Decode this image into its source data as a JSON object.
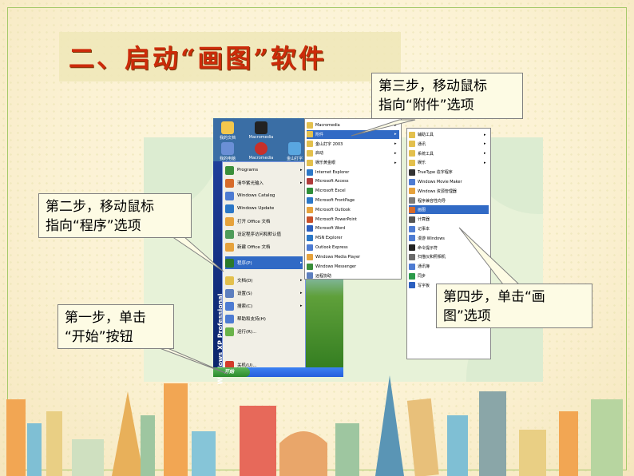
{
  "slide": {
    "title": "二、启动“画图”软件"
  },
  "callouts": {
    "step1": "第一步，单击\n“开始”按钮",
    "step2": "第二步，移动鼠标\n指向“程序”选项",
    "step3": "第三步，移动鼠标\n指向“附件”选项",
    "step4": "第四步，单击“画\n图”选项"
  },
  "desktop": {
    "icons": [
      "我的文档",
      "Macromedia",
      "我的电脑",
      "Macromedia",
      "金山打字"
    ]
  },
  "start_menu": {
    "side_label": "Windows XP Professional",
    "start_button": "开始",
    "items": [
      {
        "label": "Programs",
        "arrow": true
      },
      {
        "label": "清华紫光输入",
        "arrow": true
      },
      {
        "label": "Windows Catalog"
      },
      {
        "label": "Windows Update"
      },
      {
        "label": "打开 Office 文档"
      },
      {
        "label": "设定程序访问和默认值"
      },
      {
        "label": "新建 Office 文档"
      },
      {
        "label": "程序(P)",
        "arrow": true,
        "highlight": true
      },
      {
        "label": "文档(D)",
        "arrow": true
      },
      {
        "label": "设置(S)",
        "arrow": true
      },
      {
        "label": "搜索(C)",
        "arrow": true
      },
      {
        "label": "帮助和支持(H)"
      },
      {
        "label": "运行(R)..."
      },
      {
        "label": "关机(U)..."
      }
    ]
  },
  "programs_menu": {
    "items": [
      {
        "label": "Macromedia",
        "arrow": true
      },
      {
        "label": "附件",
        "arrow": true,
        "highlight": true
      },
      {
        "label": "金山打字 2003",
        "arrow": true
      },
      {
        "label": "启动",
        "arrow": true
      },
      {
        "label": "娱乐黄金眼",
        "arrow": true
      },
      {
        "label": "Internet Explorer"
      },
      {
        "label": "Microsoft Access"
      },
      {
        "label": "Microsoft Excel"
      },
      {
        "label": "Microsoft FrontPage"
      },
      {
        "label": "Microsoft Outlook"
      },
      {
        "label": "Microsoft PowerPoint"
      },
      {
        "label": "Microsoft Word"
      },
      {
        "label": "MSN Explorer"
      },
      {
        "label": "Outlook Express"
      },
      {
        "label": "Windows Media Player"
      },
      {
        "label": "Windows Messenger"
      },
      {
        "label": "远程协助"
      }
    ]
  },
  "accessories_menu": {
    "items": [
      {
        "label": "辅助工具",
        "arrow": true
      },
      {
        "label": "通讯",
        "arrow": true
      },
      {
        "label": "系统工具",
        "arrow": true
      },
      {
        "label": "娱乐",
        "arrow": true
      },
      {
        "label": "TrueType 造字程序"
      },
      {
        "label": "Windows Movie Maker"
      },
      {
        "label": "Windows 资源管理器"
      },
      {
        "label": "程序兼容性向导"
      },
      {
        "label": "画图",
        "highlight": true
      },
      {
        "label": "计算器"
      },
      {
        "label": "记事本"
      },
      {
        "label": "漫游 Windows"
      },
      {
        "label": "命令提示符"
      },
      {
        "label": "扫描仪和照相机"
      },
      {
        "label": "通讯簿"
      },
      {
        "label": "同步"
      },
      {
        "label": "写字板"
      }
    ]
  },
  "colors": {
    "title": "#cc2b0a",
    "highlight": "#316ac5",
    "callout_bg": "#fdfbe4"
  }
}
